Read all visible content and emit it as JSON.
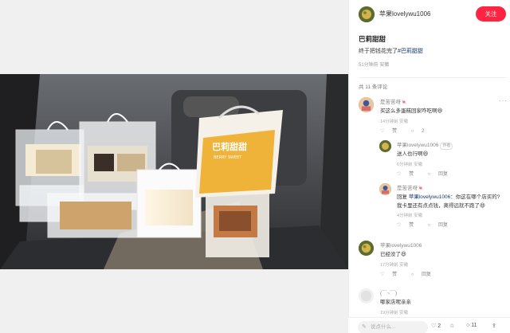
{
  "author": {
    "name": "苹果lovelywu1006",
    "follow_label": "关注"
  },
  "post": {
    "title": "巴莉甜甜",
    "body_prefix": "终于把钱花完了",
    "hashtag": "#巴莉甜甜",
    "meta": "51分钟前 安徽"
  },
  "comment_count": "共 11 条评论",
  "comments": [
    {
      "name": "是苦苦呀🍬",
      "text": "买这么多蛋糕回家咋吃啊😆",
      "meta": "14分钟前 安徽",
      "likes": "赞",
      "replies": "2"
    },
    {
      "name": "苹果lovelywu1006",
      "author_tag": "作者",
      "text": "送人也行啊😆",
      "meta": "6分钟前 安徽",
      "likes": "赞",
      "reply_label": "回复"
    },
    {
      "name": "是苦苦呀🍬",
      "text_prefix": "回复 ",
      "mention": "苹果lovelywu1006",
      "text_rest": "：你这在哪个店买的?",
      "text2": "我卡里还有点点钱，离得远就不跑了😆",
      "meta": "4分钟前 安徽",
      "likes": "赞",
      "reply_label": "回复"
    },
    {
      "name": "苹果lovelywu1006",
      "text": "已经没了😆",
      "meta": "17分钟前 安徽",
      "likes": "赞",
      "reply_label": "回复"
    },
    {
      "name": "(￣~￣)",
      "text": "哪家店呢亲亲",
      "meta": "19分钟前 安徽"
    }
  ],
  "bottombar": {
    "placeholder": "说点什么...",
    "likes": "2",
    "stars": "",
    "comments": "11"
  },
  "photo": {
    "bag_brand": "巴莉甜甜",
    "bag_brand_en": "BERRY SWEET"
  },
  "colors": {
    "accent": "#ff2442",
    "link": "#13386c"
  }
}
